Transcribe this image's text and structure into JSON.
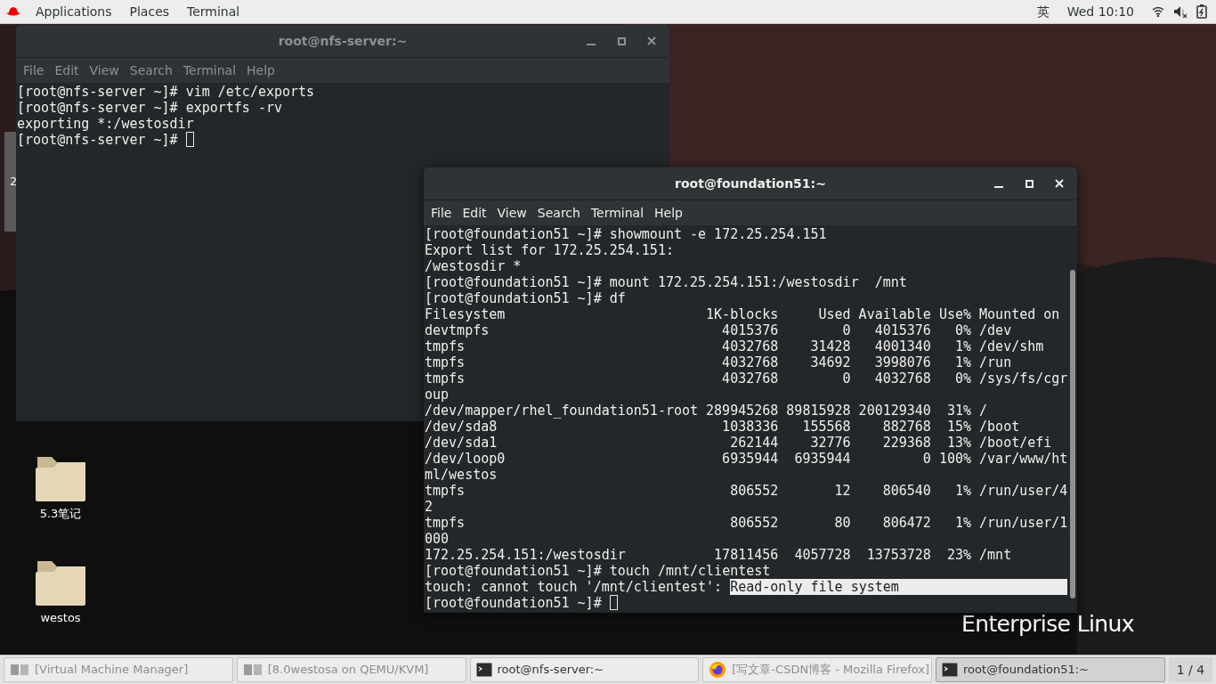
{
  "top_bar": {
    "menus": [
      "Applications",
      "Places",
      "Terminal"
    ],
    "input_method": "英",
    "clock": "Wed 10:10"
  },
  "desktop": {
    "wallpaper_text": "Enterprise Linux",
    "hidden_window_fragment": "2",
    "icons": [
      {
        "label": "5.3笔记"
      },
      {
        "label": "westos"
      }
    ]
  },
  "windows": [
    {
      "title": "root@nfs-server:~",
      "active": false,
      "menu": [
        "File",
        "Edit",
        "View",
        "Search",
        "Terminal",
        "Help"
      ],
      "lines": [
        {
          "kind": "text",
          "text": "[root@nfs-server ~]# vim /etc/exports"
        },
        {
          "kind": "text",
          "text": "[root@nfs-server ~]# exportfs -rv"
        },
        {
          "kind": "text",
          "text": "exporting *:/westosdir"
        },
        {
          "kind": "text",
          "text": "[root@nfs-server ~]# ",
          "cursor": true
        }
      ]
    },
    {
      "title": "root@foundation51:~",
      "active": true,
      "menu": [
        "File",
        "Edit",
        "View",
        "Search",
        "Terminal",
        "Help"
      ],
      "lines": [
        {
          "kind": "text",
          "text": "[root@foundation51 ~]# showmount -e 172.25.254.151"
        },
        {
          "kind": "text",
          "text": "Export list for 172.25.254.151:"
        },
        {
          "kind": "text",
          "text": "/westosdir *"
        },
        {
          "kind": "text",
          "text": "[root@foundation51 ~]# mount 172.25.254.151:/westosdir  /mnt"
        },
        {
          "kind": "text",
          "text": "[root@foundation51 ~]# df"
        },
        {
          "kind": "df",
          "cells": [
            "Filesystem",
            "1K-blocks",
            "Used",
            "Available",
            "Use%",
            "Mounted on"
          ]
        },
        {
          "kind": "df",
          "cells": [
            "devtmpfs",
            "4015376",
            "0",
            "4015376",
            "0%",
            "/dev"
          ]
        },
        {
          "kind": "df",
          "cells": [
            "tmpfs",
            "4032768",
            "31428",
            "4001340",
            "1%",
            "/dev/shm"
          ]
        },
        {
          "kind": "df",
          "cells": [
            "tmpfs",
            "4032768",
            "34692",
            "3998076",
            "1%",
            "/run"
          ]
        },
        {
          "kind": "df",
          "cells": [
            "tmpfs",
            "4032768",
            "0",
            "4032768",
            "0%",
            "/sys/fs/cgr"
          ]
        },
        {
          "kind": "text",
          "text": "oup"
        },
        {
          "kind": "df",
          "cells": [
            "/dev/mapper/rhel_foundation51-root",
            "289945268",
            "89815928",
            "200129340",
            "31%",
            "/"
          ]
        },
        {
          "kind": "df",
          "cells": [
            "/dev/sda8",
            "1038336",
            "155568",
            "882768",
            "15%",
            "/boot"
          ]
        },
        {
          "kind": "df",
          "cells": [
            "/dev/sda1",
            "262144",
            "32776",
            "229368",
            "13%",
            "/boot/efi"
          ]
        },
        {
          "kind": "df",
          "cells": [
            "/dev/loop0",
            "6935944",
            "6935944",
            "0",
            "100%",
            "/var/www/ht"
          ]
        },
        {
          "kind": "text",
          "text": "ml/westos"
        },
        {
          "kind": "df",
          "cells": [
            "tmpfs",
            "806552",
            "12",
            "806540",
            "1%",
            "/run/user/4"
          ]
        },
        {
          "kind": "text",
          "text": "2"
        },
        {
          "kind": "df",
          "cells": [
            "tmpfs",
            "806552",
            "80",
            "806472",
            "1%",
            "/run/user/1"
          ]
        },
        {
          "kind": "text",
          "text": "000"
        },
        {
          "kind": "df",
          "cells": [
            "172.25.254.151:/westosdir",
            "17811456",
            "4057728",
            "13753728",
            "23%",
            "/mnt"
          ]
        },
        {
          "kind": "text",
          "text": "[root@foundation51 ~]# touch /mnt/clientest"
        },
        {
          "kind": "text",
          "text": "touch: cannot touch '/mnt/clientest': ",
          "selected_text": "Read-only file system"
        },
        {
          "kind": "text",
          "text": "[root@foundation51 ~]# ",
          "cursor": true
        }
      ]
    }
  ],
  "taskbar": {
    "items": [
      {
        "kind": "vm",
        "label": "[Virtual Machine Manager]",
        "selected": false
      },
      {
        "kind": "vm",
        "label": "[8.0westosa on QEMU/KVM]",
        "selected": false
      },
      {
        "kind": "terminal",
        "label": "root@nfs-server:~",
        "selected": false
      },
      {
        "kind": "browser",
        "label": "[写文章-CSDN博客 - Mozilla Firefox]",
        "selected": false
      },
      {
        "kind": "terminal",
        "label": "root@foundation51:~",
        "selected": true
      }
    ],
    "pager": "1 / 4"
  }
}
